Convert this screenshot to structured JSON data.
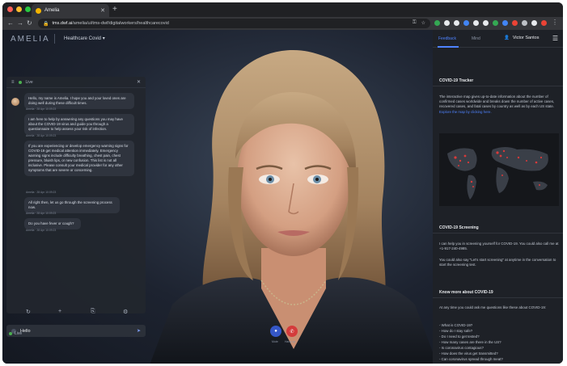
{
  "browser": {
    "tab_title": "Amelia",
    "url_host": "tms.dwf.ai",
    "url_path": "/amelia/ui/tms-dwf/digitalworkers/healthcarecovid"
  },
  "app": {
    "logo": "AMELIA",
    "workspace": "Healthcare Covid",
    "workspace_caret": "▾"
  },
  "chat": {
    "status": "Live",
    "messages": [
      {
        "html_id": "m1",
        "text": "Hello, my name is Amelia. I hope you and your loved ones are doing well during these difficult times.",
        "meta": "Amelia · 28 Apr 10:09:23"
      },
      {
        "html_id": "m2",
        "text": "I am here to help by answering any questions you may have about the COVID-19 virus and guide you through a questionnaire to help assess your risk of infection.",
        "meta": "Amelia · 28 Apr 10:09:23"
      },
      {
        "html_id": "m3",
        "text": "If you are experiencing or develop emergency warning signs for COVID-19 get medical attention immediately. Emergency warning signs include difficulty breathing, chest pain, chest pressure, bluish lips, or new confusion. This list is not all inclusive. Please consult your medical provider for any other symptoms that are severe or concerning.",
        "meta": "Amelia · 28 Apr 10:09:23"
      },
      {
        "html_id": "m4",
        "text": "All right then, let us go through the screening process now.",
        "meta": "Amelia · 28 Apr 10:09:23"
      },
      {
        "html_id": "m5",
        "text": "Do you have fever or cough?",
        "meta": "Amelia · 28 Apr 10:09:23"
      }
    ],
    "composer_value": "Hello",
    "live_label": "Live"
  },
  "controls": {
    "left_label": "Mute",
    "right_label": "Hang up"
  },
  "panel": {
    "tabs": [
      "Feedback",
      "Mind"
    ],
    "user": "Victor Santos",
    "tracker_title": "COVID-19 Tracker",
    "tracker_text": "The interactive map gives up-to-date information about the number of confirmed cases worldwide and breaks down the number of active cases, recovered cases, and fatal cases by country as well as by each US state.",
    "tracker_link": "Explore the map by clicking here.",
    "screening_title": "COVID-19 Screening",
    "screening_text": "I can help you in screening yourself for COVID-19. You could also call me at +1-917-240-4985.",
    "screening_text2": "You could also say \"Let's start screening\" at anytime in the conversation to start the screening test.",
    "knowmore_title": "Know more about COVID-19",
    "knowmore_text": "At any time you could ask me questions like these about COVID-19:",
    "questions": [
      "- What is COVID-19?",
      "- How do I stay safe?",
      "- Do I need to get tested?",
      "- How many cases are there in the US?",
      "- Is coronavirus contagious?",
      "- How does the virus get transmitted?",
      "- Can coronavirus spread through meat?"
    ]
  },
  "colors": {
    "accent": "#4f83ff",
    "live": "#4caf50",
    "hangup": "#d43b3b",
    "mute": "#3557c8"
  }
}
